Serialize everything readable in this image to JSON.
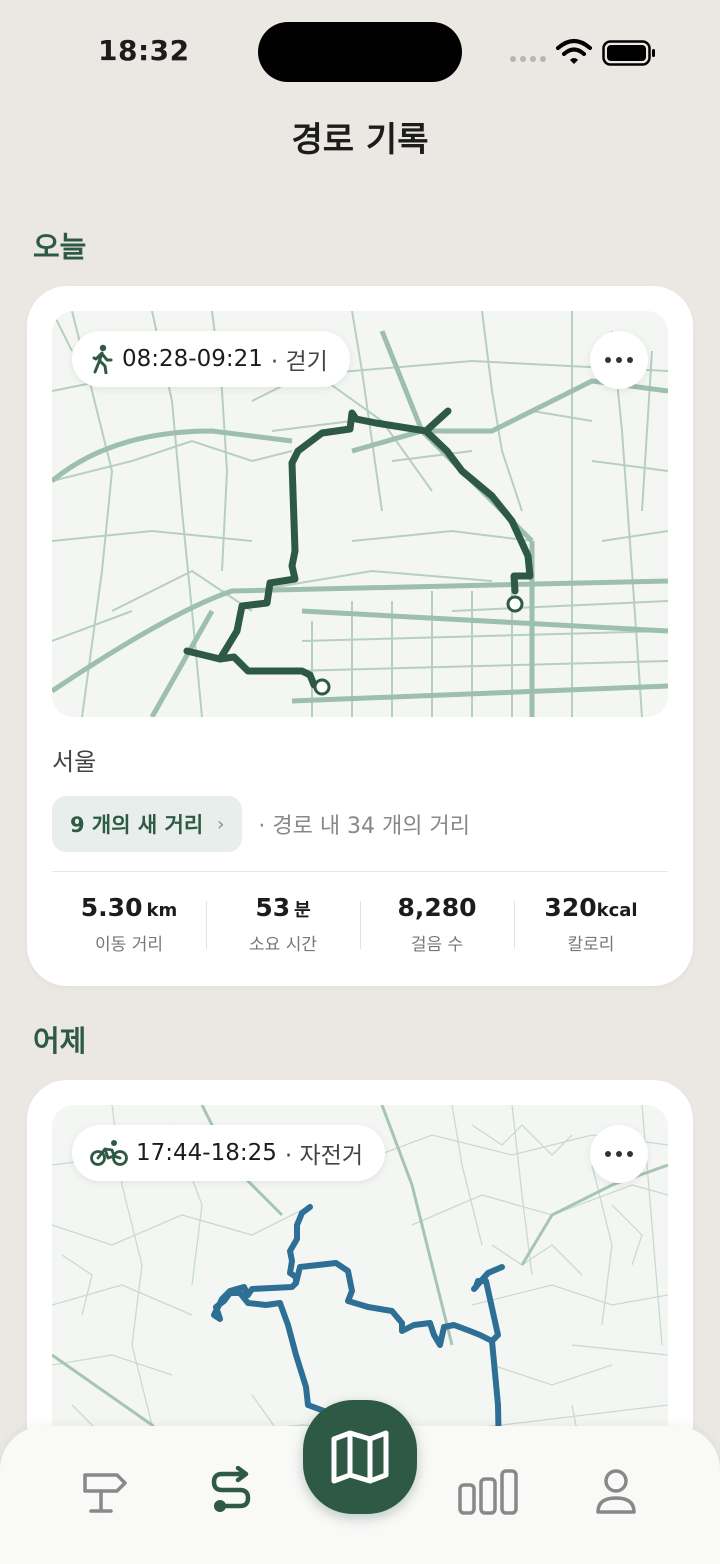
{
  "status_bar": {
    "time": "18:32"
  },
  "header": {
    "title": "경로 기록"
  },
  "sections": [
    {
      "label": "오늘",
      "route": {
        "time_range": "08:28-09:21",
        "activity": "· 걷기",
        "activity_icon": "walking-icon",
        "route_color": "#2e5a45",
        "location": "서울",
        "new_distance_label": "9 개의 새 거리",
        "distance_note": "· 경로 내 34 개의 거리",
        "stats": [
          {
            "value": "5.30",
            "unit": "km",
            "label": "이동 거리"
          },
          {
            "value": "53",
            "unit": "분",
            "label": "소요 시간"
          },
          {
            "value": "8,280",
            "unit": "",
            "label": "걸음 수"
          },
          {
            "value": "320",
            "unit": "kcal",
            "label": "칼로리"
          }
        ]
      }
    },
    {
      "label": "어제",
      "route": {
        "time_range": "17:44-18:25",
        "activity": "· 자전거",
        "activity_icon": "bicycle-icon",
        "route_color": "#2e6f96"
      }
    }
  ],
  "bottom_nav": {
    "items": [
      {
        "icon": "signpost-icon"
      },
      {
        "icon": "route-icon",
        "active": true
      },
      {
        "icon": "map-icon",
        "primary": true
      },
      {
        "icon": "bar-chart-icon"
      },
      {
        "icon": "profile-icon"
      }
    ],
    "accent": "#2e5a45"
  }
}
